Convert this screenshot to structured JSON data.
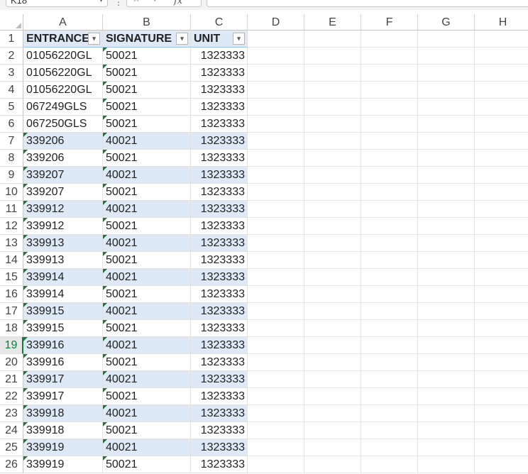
{
  "formula_bar": {
    "name_box": "K18",
    "fx": "fx",
    "value": ""
  },
  "columns": [
    "A",
    "B",
    "C",
    "D",
    "E",
    "F",
    "G",
    "H"
  ],
  "active_row": 19,
  "header_row": {
    "row": 1,
    "cells": [
      "ENTRANCE #",
      "SIGNATURE",
      "UNIT"
    ]
  },
  "rows": [
    {
      "n": 2,
      "a": "01056220GL",
      "b": "50021",
      "c": "1323333"
    },
    {
      "n": 3,
      "a": "01056220GL",
      "b": "50021",
      "c": "1323333"
    },
    {
      "n": 4,
      "a": "01056220GL",
      "b": "50021",
      "c": "1323333"
    },
    {
      "n": 5,
      "a": "067249GLS",
      "b": "50021",
      "c": "1323333"
    },
    {
      "n": 6,
      "a": "067250GLS",
      "b": "50021",
      "c": "1323333"
    },
    {
      "n": 7,
      "a": "339206",
      "b": "40021",
      "c": "1323333"
    },
    {
      "n": 8,
      "a": "339206",
      "b": "50021",
      "c": "1323333"
    },
    {
      "n": 9,
      "a": "339207",
      "b": "40021",
      "c": "1323333"
    },
    {
      "n": 10,
      "a": "339207",
      "b": "50021",
      "c": "1323333"
    },
    {
      "n": 11,
      "a": "339912",
      "b": "40021",
      "c": "1323333"
    },
    {
      "n": 12,
      "a": "339912",
      "b": "50021",
      "c": "1323333"
    },
    {
      "n": 13,
      "a": "339913",
      "b": "40021",
      "c": "1323333"
    },
    {
      "n": 14,
      "a": "339913",
      "b": "50021",
      "c": "1323333"
    },
    {
      "n": 15,
      "a": "339914",
      "b": "40021",
      "c": "1323333"
    },
    {
      "n": 16,
      "a": "339914",
      "b": "50021",
      "c": "1323333"
    },
    {
      "n": 17,
      "a": "339915",
      "b": "40021",
      "c": "1323333"
    },
    {
      "n": 18,
      "a": "339915",
      "b": "50021",
      "c": "1323333"
    },
    {
      "n": 19,
      "a": "339916",
      "b": "40021",
      "c": "1323333"
    },
    {
      "n": 20,
      "a": "339916",
      "b": "50021",
      "c": "1323333"
    },
    {
      "n": 21,
      "a": "339917",
      "b": "40021",
      "c": "1323333"
    },
    {
      "n": 22,
      "a": "339917",
      "b": "50021",
      "c": "1323333"
    },
    {
      "n": 23,
      "a": "339918",
      "b": "40021",
      "c": "1323333"
    },
    {
      "n": 24,
      "a": "339918",
      "b": "50021",
      "c": "1323333"
    },
    {
      "n": 25,
      "a": "339919",
      "b": "40021",
      "c": "1323333"
    },
    {
      "n": 26,
      "a": "339919",
      "b": "50021",
      "c": "1323333"
    }
  ],
  "colors": {
    "band": "#dde9f7",
    "accent": "#107c41",
    "error_triangle": "#1f7a3a"
  },
  "icons": [
    "chevron-down-icon",
    "cancel-icon",
    "confirm-icon",
    "filter-dropdown-icon",
    "select-all-icon",
    "number-stored-as-text-icon"
  ]
}
